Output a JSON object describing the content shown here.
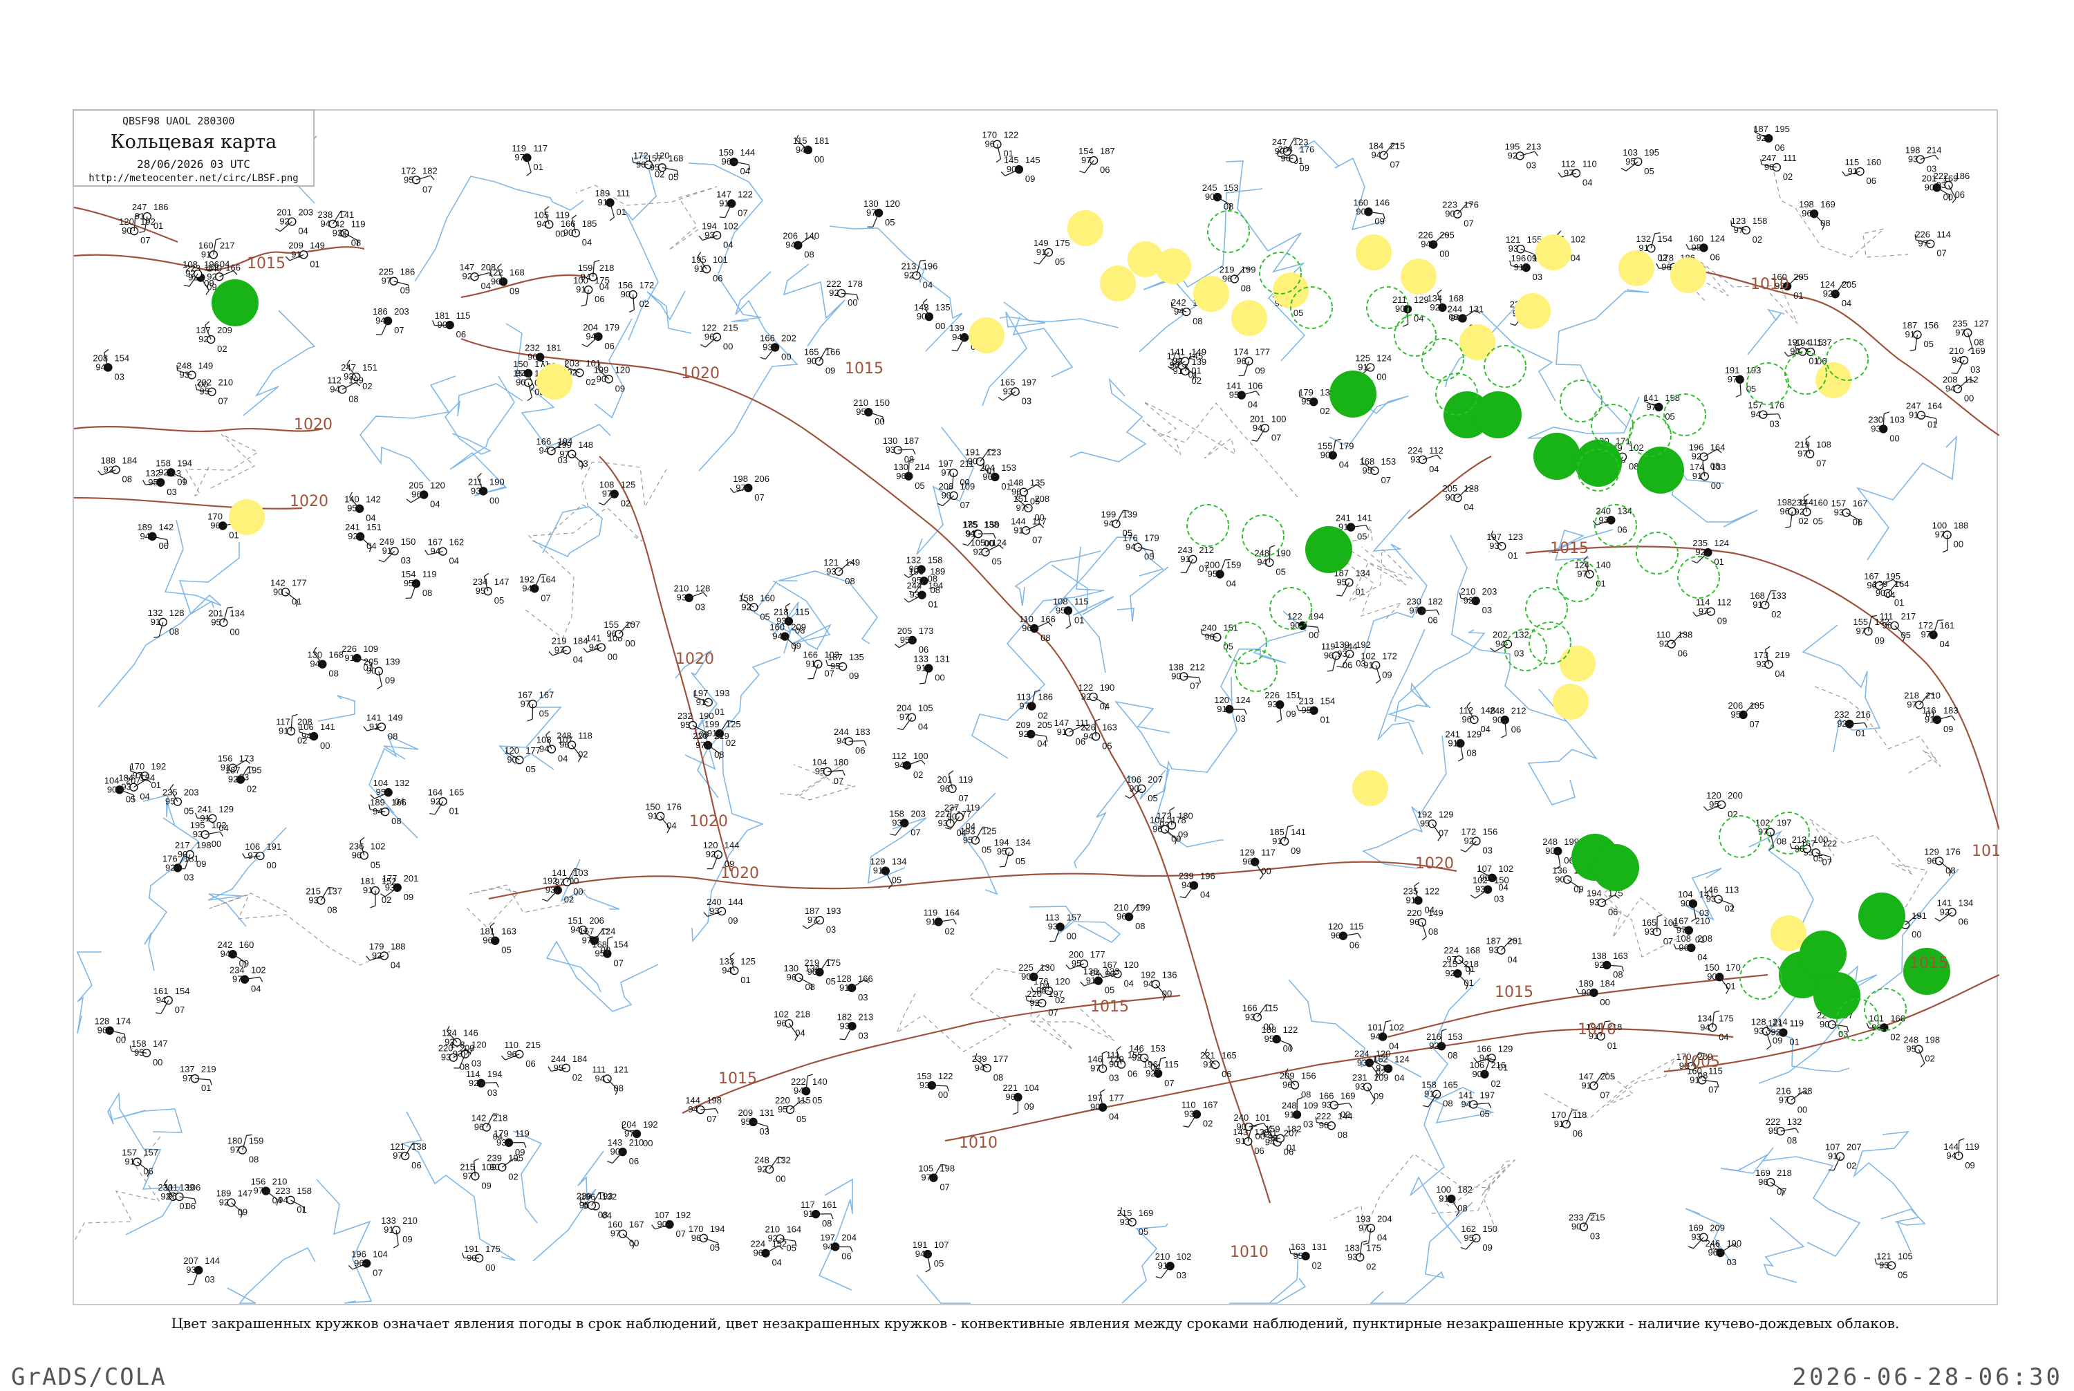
{
  "header": {
    "code": "QBSF98 UAOL 280300",
    "title": "Кольцевая карта",
    "datetime": "28/06/2026 03 UTC",
    "url": "http://meteocenter.net/circ/LBSF.png"
  },
  "caption": "Цвет закрашенных кружков означает явления погоды в срок наблюдений, цвет незакрашенных кружков - конвективные явления между сроками наблюдений, пунктирные незакрашенные кружки - наличие кучево-дождевых облаков.",
  "footer": {
    "left": "GrADS/COLA",
    "right": "2026-06-28-06:30"
  },
  "colors": {
    "isobar": "#a0523b",
    "river": "#7fb8e8",
    "shower": "#17b317",
    "haze": "#fff27a",
    "cb_ring": "#2fbf2f",
    "frame": "#c8c8c8"
  },
  "isobars": [
    "1005",
    "1010",
    "1015",
    "1020"
  ],
  "symbols": {
    "station": "station-circle-icon",
    "shower": "shower-dot-icon",
    "haze": "haze-dot-icon",
    "cb": "cumulonimbus-ring-icon"
  }
}
